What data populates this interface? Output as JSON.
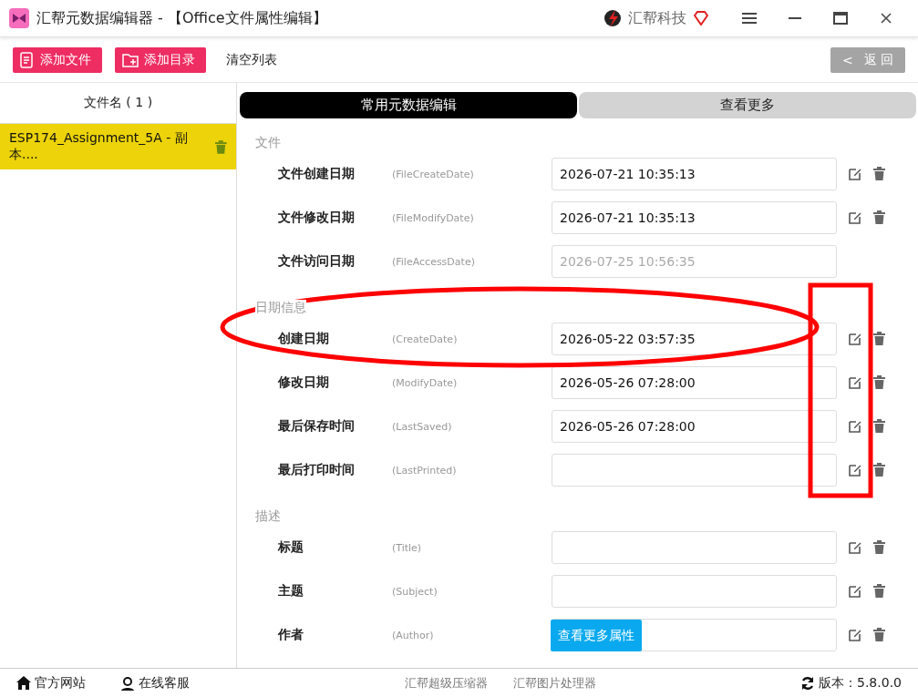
{
  "window": {
    "title": "汇帮元数据编辑器 - 【Office文件属性编辑】",
    "brand": "汇帮科技"
  },
  "toolbar": {
    "buttons": [
      {
        "label": "添加文件",
        "kind": "file"
      },
      {
        "label": "添加目录",
        "kind": "folder"
      },
      {
        "label": "清空列表",
        "kind": "plain"
      }
    ],
    "back": {
      "icon": "<",
      "label": "返 回"
    }
  },
  "file_list": {
    "header": "文件名 ( 1 )",
    "items": [
      {
        "name": "ESP174_Assignment_5A - 副本....",
        "selected": true
      }
    ]
  },
  "tabs": [
    {
      "label": "常用元数据编辑",
      "selected": true
    },
    {
      "label": "查看更多",
      "selected": false
    }
  ],
  "sections": [
    {
      "title": "文件",
      "fields": [
        {
          "label": "文件创建日期",
          "hint": "(FileCreateDate)",
          "value": "2026-07-21 10:35:13"
        },
        {
          "label": "文件修改日期",
          "hint": "(FileModifyDate)",
          "value": "2026-07-21 10:35:13"
        },
        {
          "label": "文件访问日期",
          "hint": "(FileAccessDate)",
          "value": "2026-07-25 10:56:35",
          "disabled": true
        }
      ]
    },
    {
      "title": "日期信息",
      "fields": [
        {
          "label": "创建日期",
          "hint": "(CreateDate)",
          "value": "2026-05-22 03:57:35"
        },
        {
          "label": "修改日期",
          "hint": "(ModifyDate)",
          "value": "2026-05-26 07:28:00"
        },
        {
          "label": "最后保存时间",
          "hint": "(LastSaved)",
          "value": "2026-05-26 07:28:00"
        },
        {
          "label": "最后打印时间",
          "hint": "(LastPrinted)"
        }
      ]
    },
    {
      "title": "描述",
      "fields": [
        {
          "label": "标题",
          "hint": "(Title)"
        },
        {
          "label": "主题",
          "hint": "(Subject)"
        },
        {
          "label": "作者",
          "hint": "(Author)"
        }
      ]
    }
  ],
  "more_button": "查看更多属性",
  "annotations": [
    {
      "kind": "ellipse"
    },
    {
      "kind": "rect"
    }
  ],
  "status_bar": {
    "links": [
      {
        "label": "官方网站",
        "kind": "home"
      },
      {
        "label": "在线客服",
        "kind": "support"
      }
    ],
    "tools": [
      "汇帮超级压缩器",
      "汇帮图片处理器"
    ],
    "version": "版本：5.8.0.0"
  }
}
